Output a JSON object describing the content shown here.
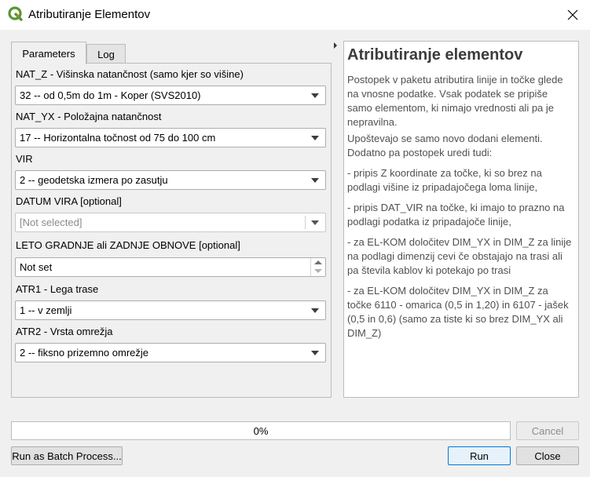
{
  "window": {
    "title": "Atributiranje Elementov",
    "app_icon": "qgis-icon",
    "close_icon": "close-icon"
  },
  "tabs": [
    {
      "label": "Parameters",
      "active": true
    },
    {
      "label": "Log",
      "active": false
    }
  ],
  "params": {
    "nat_z": {
      "label": "NAT_Z - Višinska natančnost (samo kjer so višine)",
      "value": "32 -- od 0,5m do 1m - Koper (SVS2010)"
    },
    "nat_yx": {
      "label": "NAT_YX - Položajna natančnost",
      "value": "17 -- Horizontalna točnost od 75 do 100 cm"
    },
    "vir": {
      "label": "VIR",
      "value": "2 -- geodetska izmera po zasutju"
    },
    "datum_vira": {
      "label": "DATUM VIRA [optional]",
      "value": "[Not selected]"
    },
    "leto": {
      "label": "LETO GRADNJE ali ZADNJE OBNOVE [optional]",
      "value": "Not set"
    },
    "atr1": {
      "label": "ATR1 - Lega trase",
      "value": "1 -- v zemlji"
    },
    "atr2": {
      "label": "ATR2 - Vrsta omrežja",
      "value": "2 -- fiksno prizemno omrežje"
    }
  },
  "help": {
    "title": "Atributiranje elementov",
    "p1": "Postopek v paketu atributira linije in točke glede na vnosne podatke. Vsak podatek se pripiše samo elementom, ki nimajo vrednosti ali pa je nepravilna.",
    "p2": "Upoštevajo se samo novo dodani elementi. Dodatno pa postopek uredi tudi:",
    "p3": "- pripis Z koordinate za točke, ki so brez na podlagi višine iz pripadajočega loma linije,",
    "p4": "- pripis DAT_VIR na točke, ki imajo to prazno na podlagi podatka iz pripadajoče linije,",
    "p5": "- za EL-KOM določitev DIM_YX in DIM_Z za linije na podlagi dimenzij cevi če obstajajo na trasi ali pa števila kablov ki potekajo po trasi",
    "p6": "- za EL-KOM določitev DIM_YX in DIM_Z za točke 6110 - omarica (0,5 in 1,20) in 6107 - jašek (0,5 in 0,6) (samo za tiste ki so brez DIM_YX ali DIM_Z)"
  },
  "progress": {
    "text": "0%",
    "value": 0
  },
  "buttons": {
    "cancel": "Cancel",
    "batch": "Run as Batch Process...",
    "run": "Run",
    "close": "Close"
  },
  "colors": {
    "accent": "#0078d7",
    "qgis_green": "#589632",
    "qgis_yellow": "#ee7913"
  }
}
